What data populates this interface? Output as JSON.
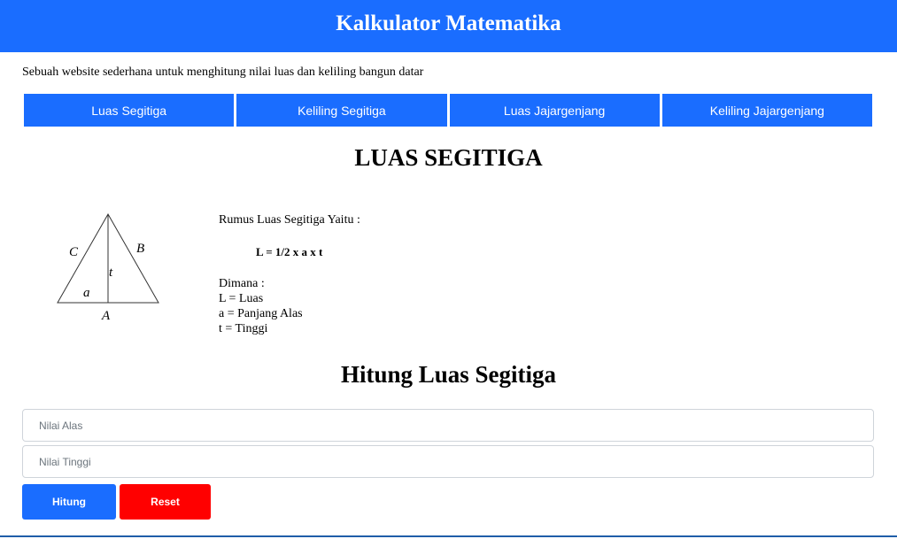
{
  "colors": {
    "primary": "#1a6dff",
    "reset": "#ff0000",
    "white": "#ffffff"
  },
  "header": {
    "title": "Kalkulator Matematika"
  },
  "subtitle": "Sebuah website sederhana untuk menghitung nilai luas dan keliling bangun datar",
  "nav": {
    "items": [
      {
        "label": "Luas Segitiga"
      },
      {
        "label": "Keliling Segitiga"
      },
      {
        "label": "Luas Jajargenjang"
      },
      {
        "label": "Keliling Jajargenjang"
      }
    ]
  },
  "section": {
    "title": "LUAS SEGITIGA",
    "diagram_labels": {
      "a": "a",
      "b": "B",
      "c": "C",
      "t": "t",
      "base": "A"
    },
    "formula_intro": "Rumus Luas Segitiga Yaitu :",
    "formula": "L = 1/2 x a x t",
    "where_label": "Dimana :",
    "definitions": [
      "L = Luas",
      "a = Panjang Alas",
      "t = Tinggi"
    ]
  },
  "calculator": {
    "title": "Hitung Luas Segitiga",
    "alas_placeholder": "Nilai Alas",
    "tinggi_placeholder": "Nilai Tinggi",
    "hitung_label": "Hitung",
    "reset_label": "Reset"
  }
}
